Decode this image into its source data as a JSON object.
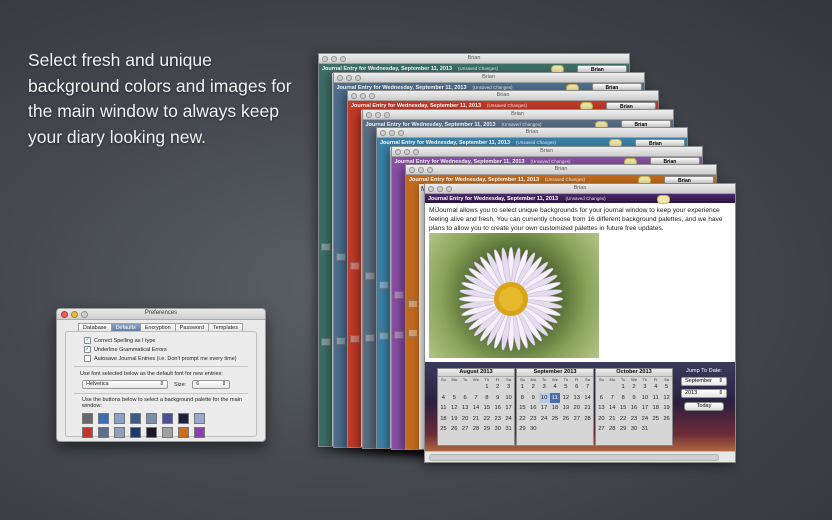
{
  "tagline": "Select fresh and unique background colors and images for the main window to always keep your diary looking new.",
  "prefs": {
    "title": "Preferences",
    "tabs": [
      "Database",
      "Defaults",
      "Encryption",
      "Password",
      "Templates"
    ],
    "selected_tab": "Defaults",
    "check_spelling": "Correct Spelling as I type",
    "check_grammar": "Underline Grammatical Errors",
    "check_autosave": "Autosave Journal Entries (i.e. Don't prompt me every time)",
    "font_label": "Use font selected below as the default font for new entries:",
    "font_value": "Helvetica",
    "size_label": "Size:",
    "size_value": "6",
    "palette_label": "Use the buttons below to select a background palette for the main window:",
    "swatches": [
      "#6a6a6a",
      "#3b6fb6",
      "#8aa1c7",
      "#3e5a86",
      "#7b8fa8",
      "#4a4f9a",
      "#1d1f3d",
      "#9aa8d0",
      "#c8332b",
      "#5b6f8a",
      "#8f9fbc",
      "#1b3a6b",
      "#1a1a22",
      "#a0a0a0",
      "#d06a1c",
      "#8a3fb3"
    ]
  },
  "window": {
    "title": "Brian",
    "entry_title": "Journal Entry for Wednesday, September 11, 2013",
    "unsaved": "(Unsaved Changes)",
    "user": "Brian",
    "body": "MiJournal allows you to select unique backgrounds for your journal window to keep your experience feeling alive and fresh.  You can currently choose from 16 different background palettes, and we have plans to allow you to create your own customized palettes in future free updates.",
    "mini_lines": [
      "MiJo",
      "feeli",
      "plan"
    ],
    "stack_colors": [
      "#3d6f66",
      "#4e6f8f",
      "#c33a28",
      "#5c6f86",
      "#3b82a8",
      "#8c4fa8",
      "#c06a1e"
    ]
  },
  "calendar": {
    "days_header": [
      "Su",
      "Mo",
      "Tu",
      "We",
      "Th",
      "Fr",
      "Sa"
    ],
    "months": [
      {
        "title": "August 2013",
        "days": [
          "",
          "",
          "",
          "",
          "1",
          "2",
          "3",
          "4",
          "5",
          "6",
          "7",
          "8",
          "9",
          "10",
          "11",
          "12",
          "13",
          "14",
          "15",
          "16",
          "17",
          "18",
          "19",
          "20",
          "21",
          "22",
          "23",
          "24",
          "25",
          "26",
          "27",
          "28",
          "29",
          "30",
          "31"
        ]
      },
      {
        "title": "September 2013",
        "days": [
          "1",
          "2",
          "3",
          "4",
          "5",
          "6",
          "7",
          "8",
          "9",
          "10",
          "11",
          "12",
          "13",
          "14",
          "15",
          "16",
          "17",
          "18",
          "19",
          "20",
          "21",
          "22",
          "23",
          "24",
          "25",
          "26",
          "27",
          "28",
          "29",
          "30"
        ]
      },
      {
        "title": "October 2013",
        "days": [
          "",
          "",
          "1",
          "2",
          "3",
          "4",
          "5",
          "6",
          "7",
          "8",
          "9",
          "10",
          "11",
          "12",
          "13",
          "14",
          "15",
          "16",
          "17",
          "18",
          "19",
          "20",
          "21",
          "22",
          "23",
          "24",
          "25",
          "26",
          "27",
          "28",
          "29",
          "30",
          "31"
        ]
      }
    ],
    "jump_label": "Jump To Date:",
    "jump_month": "September",
    "jump_year": "2013",
    "today_button": "Today"
  }
}
